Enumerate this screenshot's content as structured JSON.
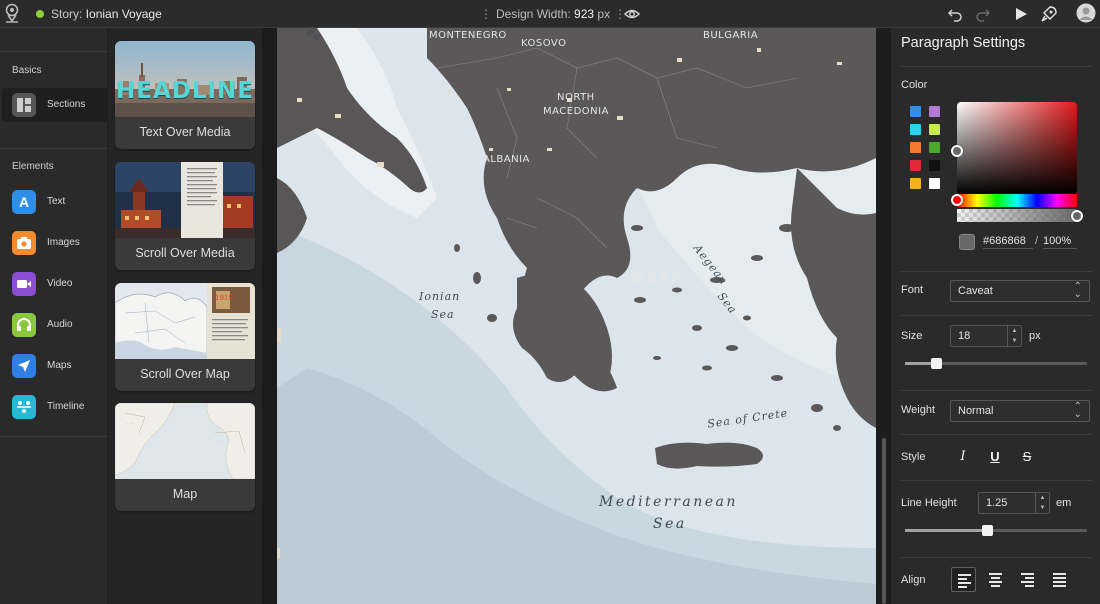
{
  "topbar": {
    "story_prefix": "Story:",
    "story_title": "Ionian Voyage",
    "design_width_label": "Design Width:",
    "design_width_value": "923",
    "design_width_unit": "px",
    "kebab": "⋮",
    "status_color": "#8bd23b"
  },
  "rail": {
    "basics_title": "Basics",
    "elements_title": "Elements",
    "basics_items": [
      {
        "label": "Sections",
        "icon": "sections-icon",
        "color": "#555555"
      }
    ],
    "element_items": [
      {
        "label": "Text",
        "icon": "text-icon",
        "color": "#2f8fe6"
      },
      {
        "label": "Images",
        "icon": "camera-icon",
        "color": "#f28a2e"
      },
      {
        "label": "Video",
        "icon": "video-icon",
        "color": "#8c4fd6"
      },
      {
        "label": "Audio",
        "icon": "headphones-icon",
        "color": "#8cc63e"
      },
      {
        "label": "Maps",
        "icon": "navigation-arrow-icon",
        "color": "#2f7fe6"
      },
      {
        "label": "Timeline",
        "icon": "timeline-icon",
        "color": "#26b8d6"
      }
    ]
  },
  "cards": [
    {
      "caption": "Text Over Media",
      "thumb_text": "HEADLINE"
    },
    {
      "caption": "Scroll Over Media"
    },
    {
      "caption": "Scroll Over Map"
    },
    {
      "caption": "Map"
    }
  ],
  "map": {
    "labels": {
      "montenegro": "MONTENEGRO",
      "kosovo": "KOSOVO",
      "bulgaria": "BULGARIA",
      "north_macedonia_1": "NORTH",
      "north_macedonia_2": "MACEDONIA",
      "albania": "ALBANIA",
      "greece": "GREE",
      "ionian_1": "Ionian",
      "ionian_2": "Sea",
      "aegean_1": "Aegean",
      "aegean_2": "Sea",
      "crete_sea": "Sea of Crete",
      "med_1": "Mediterranean",
      "med_2": "Sea",
      "edge": "ea"
    }
  },
  "panel": {
    "title": "Paragraph Settings",
    "color_label": "Color",
    "swatches": [
      "#2f8fe6",
      "#b07ad6",
      "#2ad4f0",
      "#c6e84a",
      "#f07a2e",
      "#4aa82e",
      "#e02a3a",
      "#111111",
      "#f5b021",
      "#ffffff"
    ],
    "hex_value": "#686868",
    "opacity_value": "100",
    "opacity_unit": "%",
    "slash": "/",
    "font_label": "Font",
    "font_value": "Caveat",
    "size_label": "Size",
    "size_value": "18",
    "size_unit": "px",
    "size_slider_value": 0.17,
    "weight_label": "Weight",
    "weight_value": "Normal",
    "style_label": "Style",
    "style_buttons": {
      "italic": "I",
      "underline": "U",
      "strike": "S"
    },
    "line_height_label": "Line Height",
    "line_height_value": "1.25",
    "line_height_unit": "em",
    "line_height_slider_value": 0.45,
    "align_label": "Align"
  }
}
